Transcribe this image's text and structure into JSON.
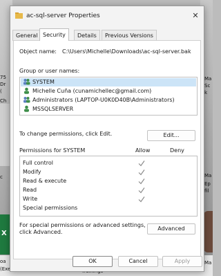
{
  "background": {
    "left_text_1": "75",
    "left_text_2": "Dr",
    "left_text_3": "(",
    "left_text_4": "Ch",
    "left_text_5": "c",
    "bottom_left_caption": "oa",
    "bottom_left_caption_2": "(Exercise)",
    "bottom_mid_caption": "Trainings",
    "right_text_1": "Ma",
    "right_text_2": "Sc",
    "right_text_3": "k",
    "right_text_4": "Ma",
    "right_text_5": "Ep",
    "right_text_6": "fil",
    "right_text_7": "Ma"
  },
  "window": {
    "title": "ac-sql-server Properties",
    "close_glyph": "✕"
  },
  "tabs": [
    {
      "label": "General"
    },
    {
      "label": "Security"
    },
    {
      "label": "Details"
    },
    {
      "label": "Previous Versions"
    }
  ],
  "security": {
    "object_name_label": "Object name:",
    "object_name_value": "C:\\Users\\Michelle\\Downloads\\ac-sql-server.bak",
    "group_label": "Group or user names:",
    "principals": [
      {
        "name": "SYSTEM",
        "icon": "group-users-icon"
      },
      {
        "name": "Michelle Cuña (cunamichellec@gmail.com)",
        "icon": "user-icon"
      },
      {
        "name": "Administrators (LAPTOP-U0K0D40B\\Administrators)",
        "icon": "group-users-icon"
      },
      {
        "name": "MSSQLSERVER",
        "icon": "user-icon"
      }
    ],
    "change_perm_text": "To change permissions, click Edit.",
    "edit_button": "Edit...",
    "permissions_for": "Permissions for SYSTEM",
    "allow_header": "Allow",
    "deny_header": "Deny",
    "permissions": [
      {
        "name": "Full control",
        "allow": true
      },
      {
        "name": "Modify",
        "allow": true
      },
      {
        "name": "Read & execute",
        "allow": true
      },
      {
        "name": "Read",
        "allow": true
      },
      {
        "name": "Write",
        "allow": true
      },
      {
        "name": "Special permissions",
        "allow": false
      }
    ],
    "advanced_text_1": "For special permissions or advanced settings,",
    "advanced_text_2": "click Advanced.",
    "advanced_button": "Advanced"
  },
  "footer": {
    "ok": "OK",
    "cancel": "Cancel",
    "apply": "Apply"
  },
  "colors": {
    "selection": "#cce4f7",
    "check": "#8a8a8a"
  }
}
